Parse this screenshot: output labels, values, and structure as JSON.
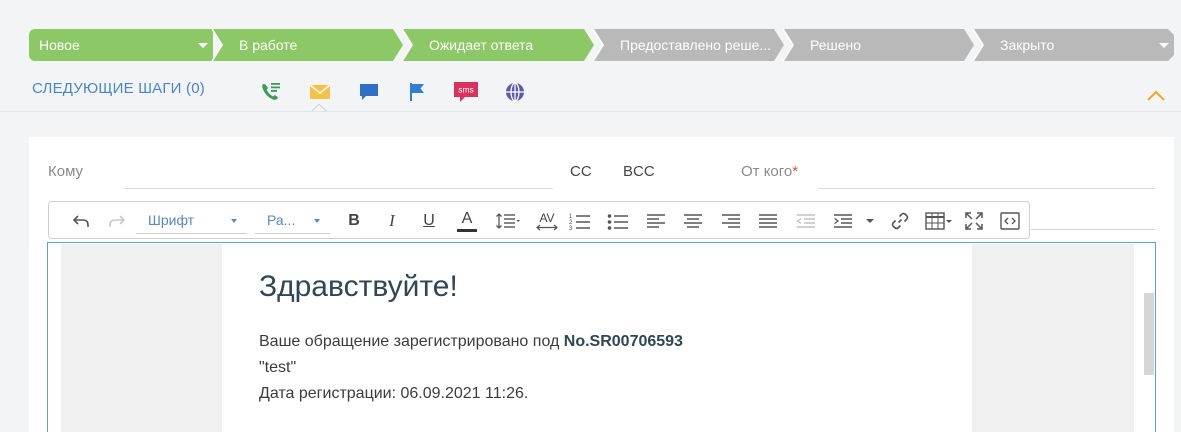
{
  "stages": [
    {
      "label": "Новое",
      "state": "done",
      "has_dropdown": true
    },
    {
      "label": "В работе",
      "state": "done"
    },
    {
      "label": "Ожидает ответа",
      "state": "done"
    },
    {
      "label": "Предоставлено реше...",
      "state": "todo"
    },
    {
      "label": "Решено",
      "state": "todo"
    },
    {
      "label": "Закрыто",
      "state": "todo",
      "has_dropdown": true
    }
  ],
  "colors": {
    "stage_done": "#8cc966",
    "stage_todo": "#b9b9b9",
    "accent_blue": "#4a86c5",
    "collapse_orange": "#f5a623",
    "required_red": "#e0533d",
    "editor_border": "#5aa7c9"
  },
  "next_steps": {
    "title": "СЛЕДУЮЩИЕ ШАГИ (0)",
    "icons": [
      "phone-call-icon",
      "email-icon",
      "chat-icon",
      "flag-icon",
      "sms-icon",
      "globe-icon"
    ],
    "active": "email-icon",
    "sms_text": "sms"
  },
  "email_form": {
    "to_label": "Кому",
    "cc_label": "CC",
    "bcc_label": "BCC",
    "from_label": "От кого",
    "from_required_mark": "*"
  },
  "toolbar": {
    "font_select": "Шрифт",
    "size_select": "Ра...",
    "bold": "B",
    "italic": "I",
    "underline": "U",
    "text_color": "A",
    "letter_spacing": "AV"
  },
  "message": {
    "greeting": "Здравствуйте!",
    "line1_prefix": "Ваше обращение зарегистрировано под ",
    "line1_number": "No.SR00706593",
    "line2": "\"test\"",
    "line3": "Дата регистрации: 06.09.2021 11:26."
  }
}
